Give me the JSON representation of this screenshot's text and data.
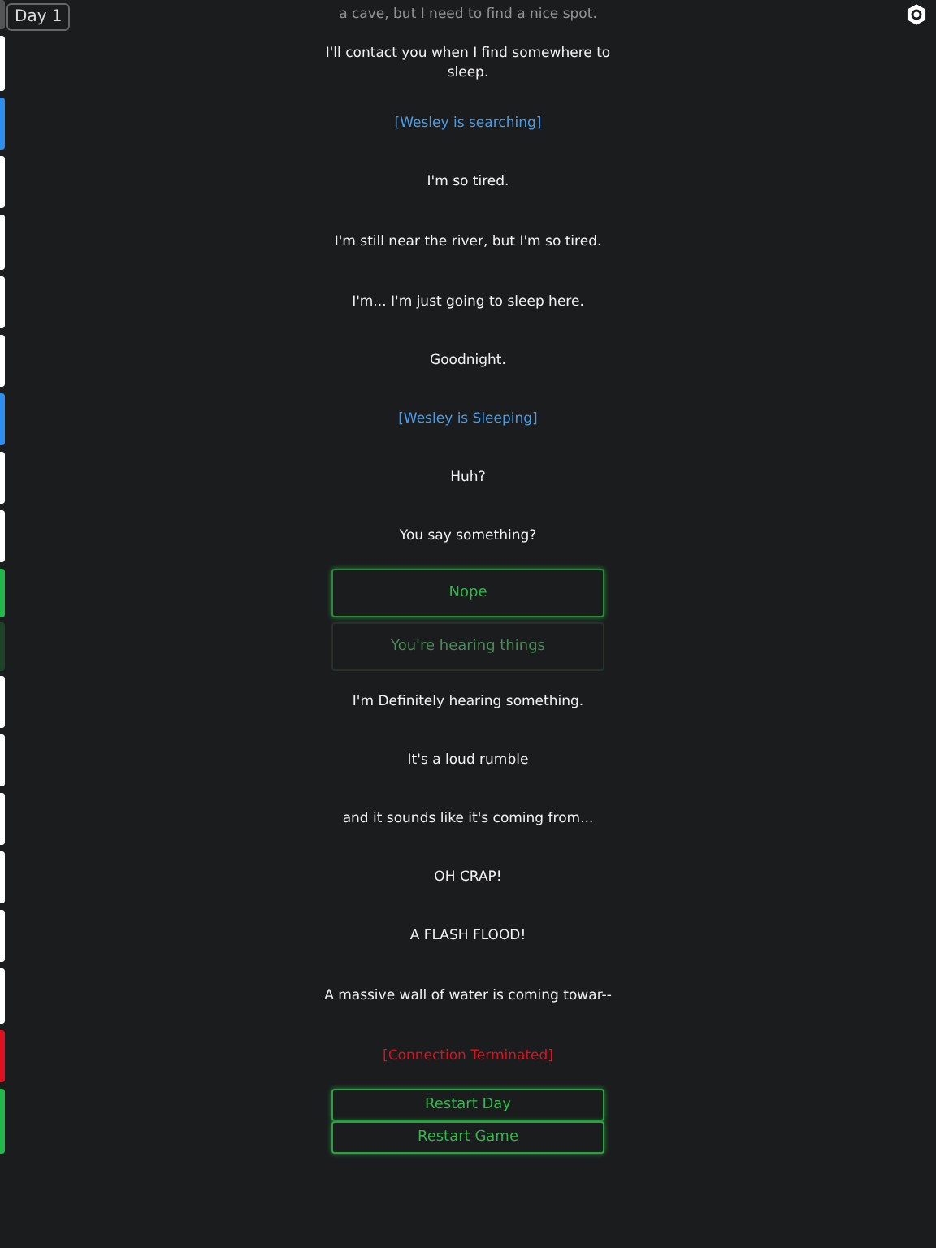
{
  "day_badge": "Day 1",
  "messages": [
    {
      "kind": "text",
      "text": "a cave, but I need to find a nice spot.",
      "faded": true
    },
    {
      "kind": "text",
      "text": "I'll contact you when I find somewhere to sleep.",
      "faded": false
    },
    {
      "kind": "status",
      "text": "[Wesley is searching]",
      "faded": false
    },
    {
      "kind": "text",
      "text": "I'm so tired.",
      "faded": false
    },
    {
      "kind": "text",
      "text": "I'm still near the river, but I'm so tired.",
      "faded": false
    },
    {
      "kind": "text",
      "text": "I'm... I'm just going to sleep here.",
      "faded": false
    },
    {
      "kind": "text",
      "text": "Goodnight.",
      "faded": false
    },
    {
      "kind": "status",
      "text": "[Wesley is Sleeping]",
      "faded": false
    },
    {
      "kind": "text",
      "text": "Huh?",
      "faded": false
    },
    {
      "kind": "text",
      "text": "You say something?",
      "faded": false
    },
    {
      "kind": "choice",
      "text": "Nope",
      "selected": true
    },
    {
      "kind": "choice",
      "text": "You're hearing things",
      "selected": false
    },
    {
      "kind": "text",
      "text": "I'm Definitely hearing something.",
      "faded": false
    },
    {
      "kind": "text",
      "text": "It's a loud rumble",
      "faded": false
    },
    {
      "kind": "text",
      "text": "and it sounds like it's coming from...",
      "faded": false
    },
    {
      "kind": "text",
      "text": "OH CRAP!",
      "faded": false
    },
    {
      "kind": "text",
      "text": "A FLASH FLOOD!",
      "faded": false
    },
    {
      "kind": "text",
      "text": "A massive wall of water is coming towar--",
      "faded": false
    },
    {
      "kind": "ending",
      "text": "[Connection Terminated]",
      "faded": false
    }
  ],
  "restart_buttons": [
    "Restart Day",
    "Restart Game"
  ]
}
